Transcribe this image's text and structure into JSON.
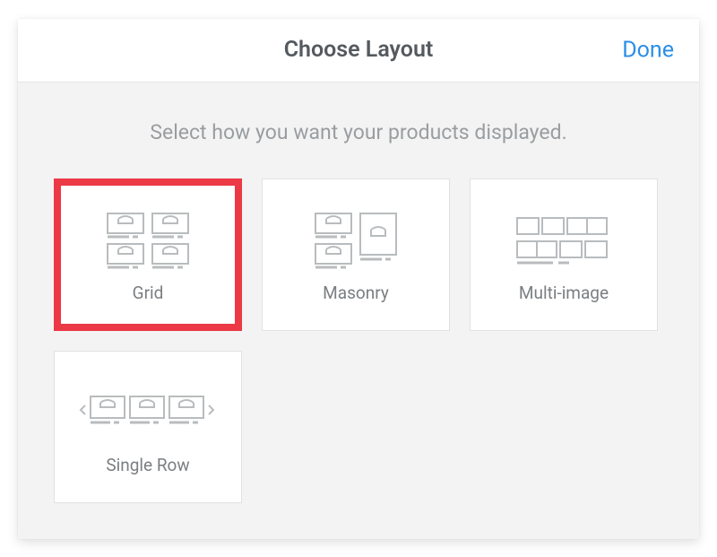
{
  "header": {
    "title": "Choose Layout",
    "done_label": "Done"
  },
  "subtitle": "Select how you want your products displayed.",
  "options": {
    "grid": {
      "label": "Grid",
      "selected": true
    },
    "masonry": {
      "label": "Masonry",
      "selected": false
    },
    "multi_image": {
      "label": "Multi-image",
      "selected": false
    },
    "single_row": {
      "label": "Single Row",
      "selected": false
    }
  },
  "colors": {
    "accent_selected": "#eb3945",
    "link": "#2b8ee6"
  }
}
